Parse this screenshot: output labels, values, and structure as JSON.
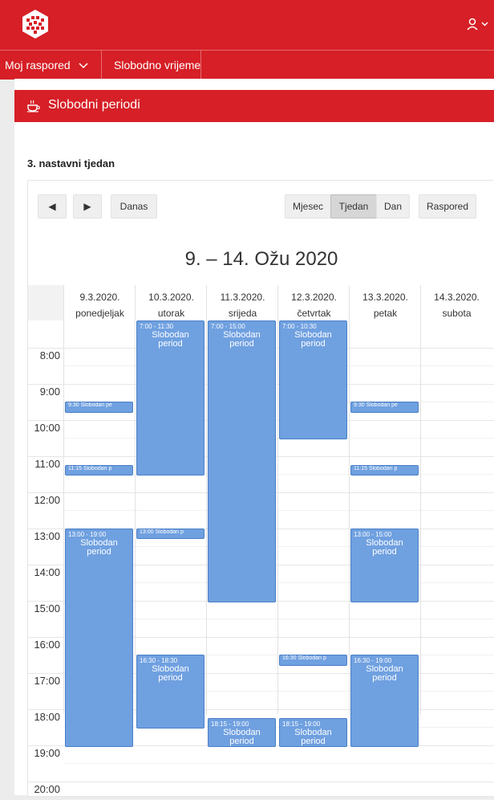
{
  "nav": {
    "my_schedule": "Moj raspored",
    "free_time": "Slobodno vrijeme"
  },
  "panel": {
    "title": "Slobodni periodi"
  },
  "week_label": "3. nastavni tjedan",
  "toolbar": {
    "prev": "◀",
    "next": "▶",
    "today": "Danas",
    "month": "Mjesec",
    "week": "Tjedan",
    "day": "Dan",
    "schedule": "Raspored"
  },
  "calendar_title": "9. – 14. Ožu 2020",
  "days": [
    {
      "date": "9.3.2020.",
      "weekday": "ponedjeljak"
    },
    {
      "date": "10.3.2020.",
      "weekday": "utorak"
    },
    {
      "date": "11.3.2020.",
      "weekday": "srijeda"
    },
    {
      "date": "12.3.2020.",
      "weekday": "četvrtak"
    },
    {
      "date": "13.3.2020.",
      "weekday": "petak"
    },
    {
      "date": "14.3.2020.",
      "weekday": "subota"
    }
  ],
  "hours": [
    "8:00",
    "9:00",
    "10:00",
    "11:00",
    "12:00",
    "13:00",
    "14:00",
    "15:00",
    "16:00",
    "17:00",
    "18:00",
    "19:00",
    "20:00"
  ],
  "events": [
    {
      "day": 0,
      "start": "9:30",
      "end": "9:45",
      "time": "9:30",
      "name": "Slobodan pe"
    },
    {
      "day": 0,
      "start": "11:15",
      "end": "11:30",
      "time": "11:15",
      "name": "Slobodan p"
    },
    {
      "day": 0,
      "start": "13:00",
      "end": "19:00",
      "time": "13:00 - 19:00",
      "name": "Slobodan period"
    },
    {
      "day": 1,
      "start": "7:00",
      "end": "11:30",
      "time": "7:00 - 11:30",
      "name": "Slobodan period"
    },
    {
      "day": 1,
      "start": "13:00",
      "end": "13:15",
      "time": "13:00",
      "name": "Slobodan p"
    },
    {
      "day": 1,
      "start": "16:30",
      "end": "18:30",
      "time": "16:30 - 18:30",
      "name": "Slobodan period"
    },
    {
      "day": 2,
      "start": "7:00",
      "end": "15:00",
      "time": "7:00 - 15:00",
      "name": "Slobodan period"
    },
    {
      "day": 2,
      "start": "18:15",
      "end": "19:00",
      "time": "18:15 - 19:00",
      "name": "Slobodan period"
    },
    {
      "day": 3,
      "start": "7:00",
      "end": "10:30",
      "time": "7:00 - 10:30",
      "name": "Slobodan period"
    },
    {
      "day": 3,
      "start": "16:30",
      "end": "16:45",
      "time": "16:30",
      "name": "Slobodan p"
    },
    {
      "day": 3,
      "start": "18:15",
      "end": "19:00",
      "time": "18:15 - 19:00",
      "name": "Slobodan period"
    },
    {
      "day": 4,
      "start": "9:30",
      "end": "9:45",
      "time": "9:30",
      "name": "Slobodan pe"
    },
    {
      "day": 4,
      "start": "11:15",
      "end": "11:30",
      "time": "11:15",
      "name": "Slobodan p"
    },
    {
      "day": 4,
      "start": "13:00",
      "end": "15:00",
      "time": "13:00 - 15:00",
      "name": "Slobodan period"
    },
    {
      "day": 4,
      "start": "16:30",
      "end": "19:00",
      "time": "16:30 - 19:00",
      "name": "Slobodan period"
    }
  ],
  "colors": {
    "brand": "#d61f26",
    "event_fill": "#6fa0e0",
    "event_border": "#4a7fc7"
  }
}
